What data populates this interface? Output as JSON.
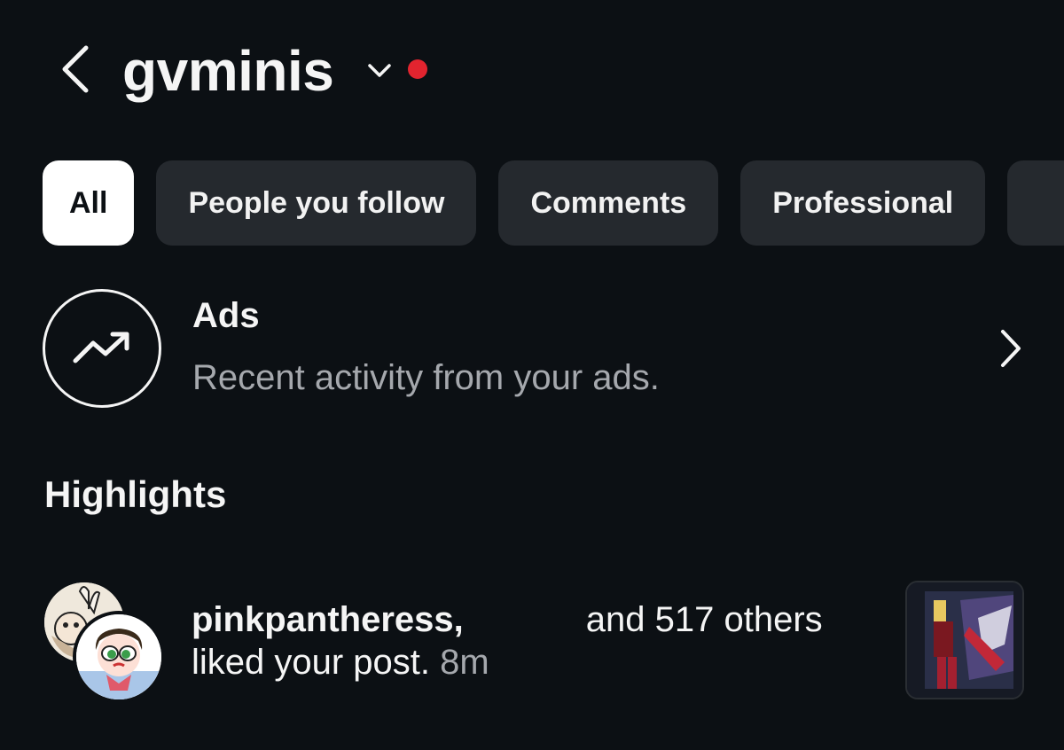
{
  "header": {
    "account_name": "gvminis",
    "back_icon": "chevron-left-icon",
    "switch_icon": "chevron-down-icon",
    "dot_color": "#e2242f"
  },
  "filters": [
    {
      "label": "All",
      "active": true
    },
    {
      "label": "People you follow",
      "active": false
    },
    {
      "label": "Comments",
      "active": false
    },
    {
      "label": "Professional",
      "active": false
    },
    {
      "label": "",
      "active": false
    }
  ],
  "ads": {
    "title": "Ads",
    "subtitle": "Recent activity from your ads.",
    "icon": "trending-up-icon"
  },
  "highlights": {
    "title": "Highlights",
    "notification": {
      "user": "pinkpantheress,",
      "others": "and 517 others",
      "action": "liked your post.",
      "time": "8m"
    }
  }
}
